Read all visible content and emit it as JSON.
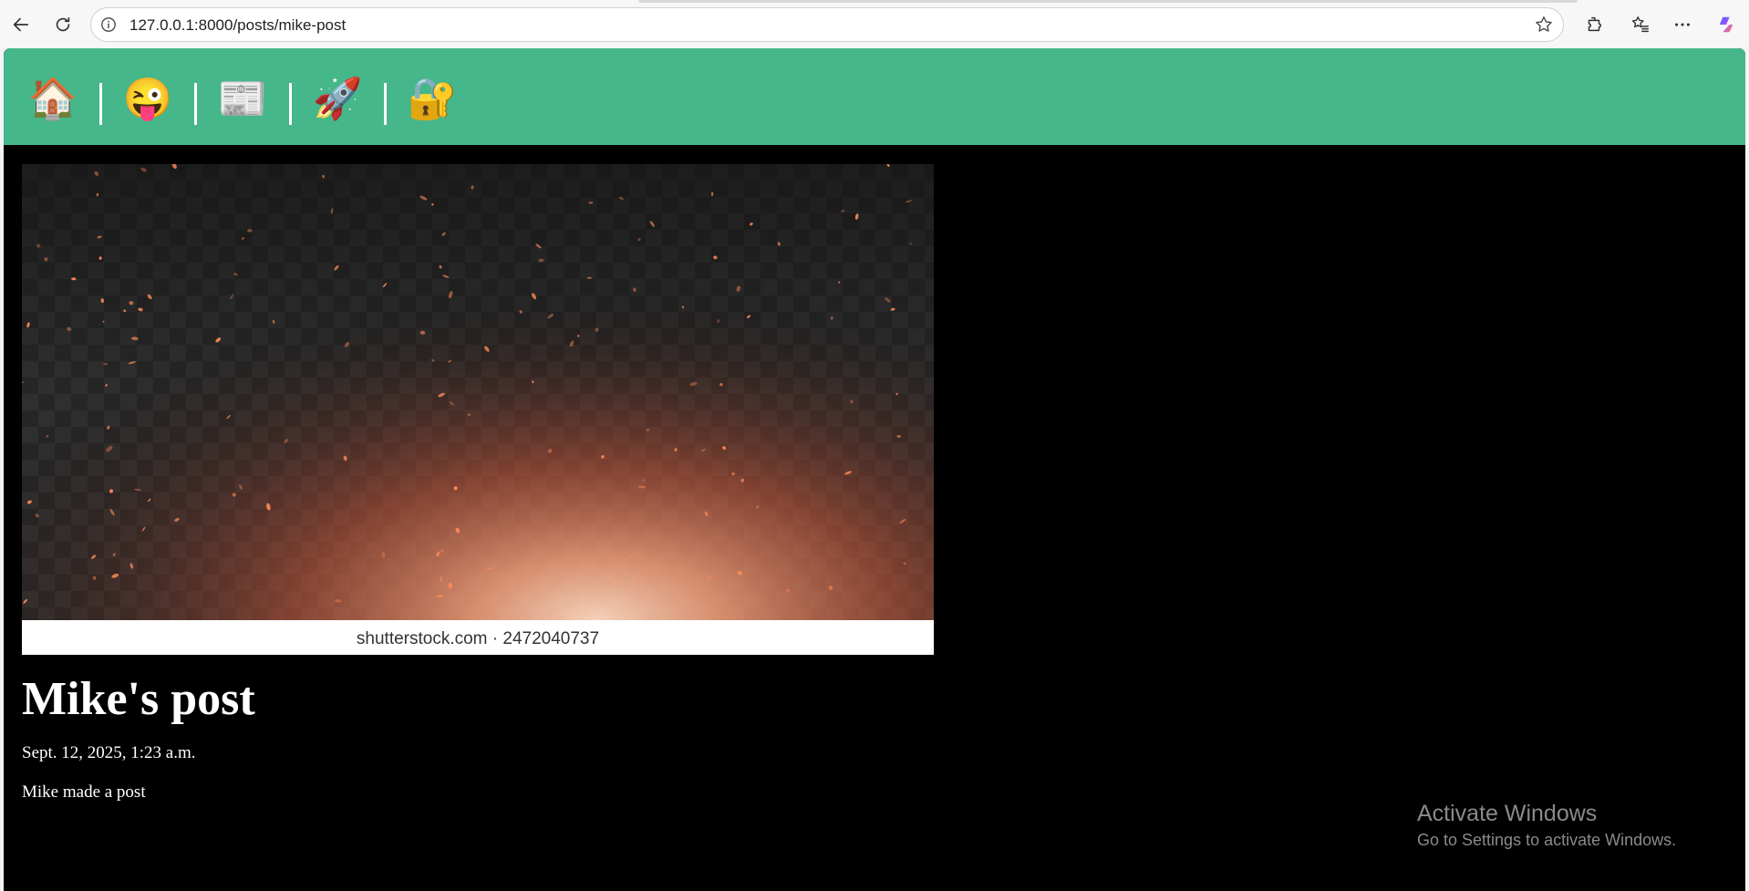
{
  "browser": {
    "url": "127.0.0.1:8000/posts/mike-post",
    "back_icon": "back-arrow-icon",
    "refresh_icon": "refresh-icon",
    "info_icon": "info-icon",
    "favorite_icon": "star-icon",
    "extensions_icon": "puzzle-icon",
    "favorites_icon": "favorites-list-icon",
    "more_icon": "more-icon",
    "copilot_icon": "copilot-icon"
  },
  "site_nav": {
    "background": "#45b78a",
    "items": [
      {
        "icon": "🏠",
        "name": "house-icon"
      },
      {
        "icon": "😜",
        "name": "zany-face-icon"
      },
      {
        "icon": "📰",
        "name": "newspaper-icon"
      },
      {
        "icon": "🚀",
        "name": "rocket-icon"
      },
      {
        "icon": "🔐",
        "name": "lock-key-icon"
      }
    ]
  },
  "post": {
    "image_caption": "shutterstock.com · 2472040737",
    "title": "Mike's post",
    "date": "Sept. 12, 2025, 1:23 a.m.",
    "body": "Mike made a post"
  },
  "watermark": {
    "title": "Activate Windows",
    "subtitle": "Go to Settings to activate Windows."
  }
}
